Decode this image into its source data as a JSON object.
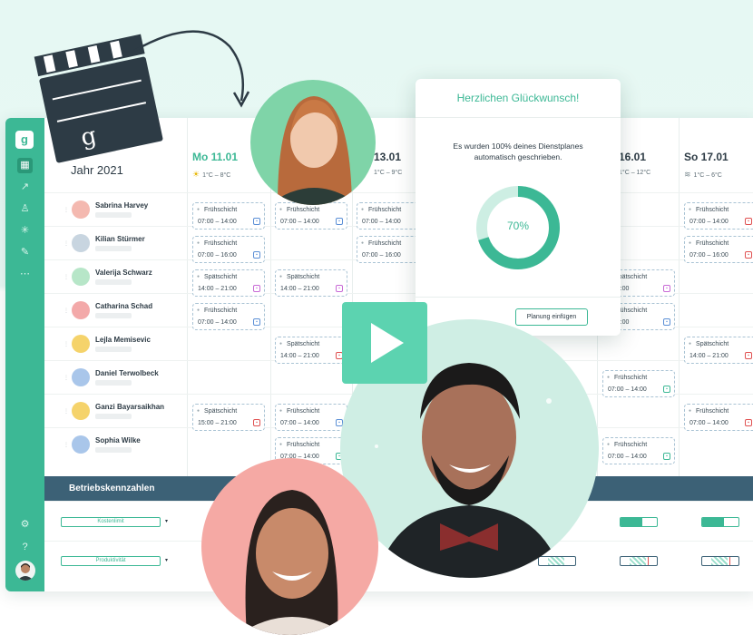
{
  "header": {
    "year_label": "Jahr 2021"
  },
  "days": [
    {
      "date": "Mo 11.01",
      "weather_icon": "sun-icon",
      "temp": "1°C – 8°C",
      "today": true
    },
    {
      "date": "13.01",
      "weather_icon": "",
      "temp": "1°C – 9°C",
      "today": false
    },
    {
      "date": "16.01",
      "weather_icon": "",
      "temp": "1°C – 12°C",
      "today": false
    },
    {
      "date": "So 17.01",
      "weather_icon": "wind-icon",
      "temp": "1°C – 6°C",
      "today": false
    }
  ],
  "employees": [
    {
      "name": "Sabrina Harvey"
    },
    {
      "name": "Kilian Stürmer"
    },
    {
      "name": "Valerija Schwarz"
    },
    {
      "name": "Catharina Schad"
    },
    {
      "name": "Lejla Memisevic"
    },
    {
      "name": "Daniel Terwolbeck"
    },
    {
      "name": "Ganzi Bayarsaikhan"
    },
    {
      "name": "Sophia Wilke"
    }
  ],
  "shift_labels": {
    "early": "Frühschicht",
    "late": "Spätschicht",
    "t_0700_1400": "07:00 – 14:00",
    "t_0700_1600": "07:00 – 16:00",
    "t_1400_2100": "14:00 – 21:00",
    "t_1500_2100": "15:00 – 21:00",
    "t_partial_1400": "– 14:00",
    "t_partial_1600": "– 16:00"
  },
  "kpi": {
    "band_title": "Betriebskennzahlen",
    "cost_limit": "Kostenlimit",
    "productivity": "Produktivität",
    "cost_limit_fill": 0.6
  },
  "modal": {
    "title": "Herzlichen Glückwunsch!",
    "message": "Es wurden 100% deines Dienstplanes automatisch geschrieben.",
    "donut_label": "70%",
    "donut_value": 70,
    "button": "Planung einfügen"
  },
  "colors": {
    "accent": "#3cb895",
    "navy": "#3c6176",
    "badge_blue": "#5b8fd6",
    "badge_pink": "#c86ad6",
    "badge_red": "#e05050",
    "badge_green": "#3cb895"
  }
}
